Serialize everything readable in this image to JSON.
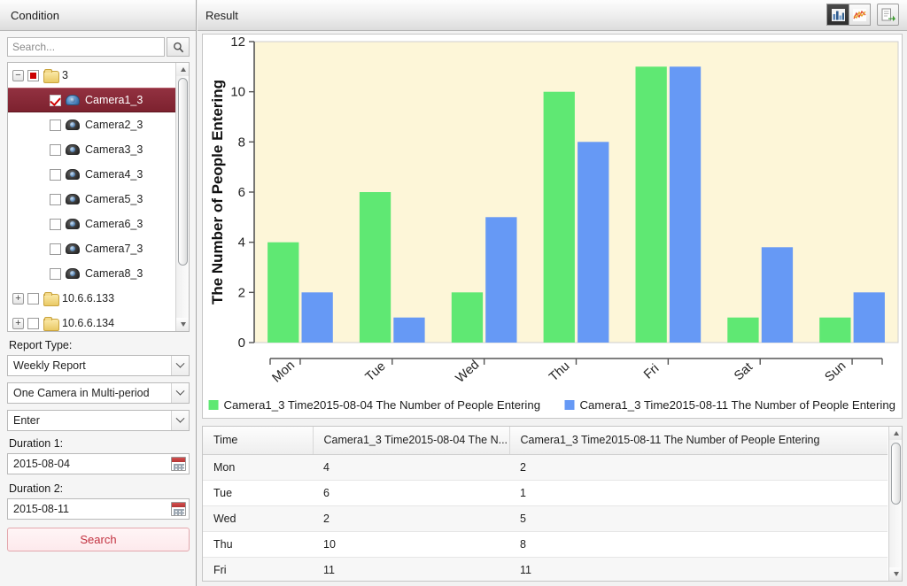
{
  "left": {
    "header": "Condition",
    "search": {
      "placeholder": "Search...",
      "value": "",
      "icon": "search-icon"
    },
    "tree": [
      {
        "label": "3",
        "type": "folder",
        "expander": "−",
        "check": "partial",
        "indent": 0,
        "selected": false
      },
      {
        "label": "Camera1_3",
        "type": "camera",
        "check": "checked",
        "indent": 2,
        "selected": true
      },
      {
        "label": "Camera2_3",
        "type": "camera",
        "check": "unchecked",
        "indent": 2,
        "selected": false
      },
      {
        "label": "Camera3_3",
        "type": "camera",
        "check": "unchecked",
        "indent": 2,
        "selected": false
      },
      {
        "label": "Camera4_3",
        "type": "camera",
        "check": "unchecked",
        "indent": 2,
        "selected": false
      },
      {
        "label": "Camera5_3",
        "type": "camera",
        "check": "unchecked",
        "indent": 2,
        "selected": false
      },
      {
        "label": "Camera6_3",
        "type": "camera",
        "check": "unchecked",
        "indent": 2,
        "selected": false
      },
      {
        "label": "Camera7_3",
        "type": "camera",
        "check": "unchecked",
        "indent": 2,
        "selected": false
      },
      {
        "label": "Camera8_3",
        "type": "camera",
        "check": "unchecked",
        "indent": 2,
        "selected": false
      },
      {
        "label": "10.6.6.133",
        "type": "folder",
        "expander": "+",
        "check": "unchecked",
        "indent": 0,
        "selected": false
      },
      {
        "label": "10.6.6.134",
        "type": "folder",
        "expander": "+",
        "check": "unchecked",
        "indent": 0,
        "selected": false
      }
    ],
    "report_type_label": "Report Type:",
    "report_type_value": "Weekly Report",
    "mode_value": "One Camera in Multi-period",
    "flow_value": "Enter",
    "duration1_label": "Duration 1:",
    "duration1_value": "2015-08-04",
    "duration2_label": "Duration 2:",
    "duration2_value": "2015-08-11",
    "search_button": "Search",
    "calendar_icon": "calendar-icon"
  },
  "right": {
    "header": "Result",
    "toolbar": {
      "bar_chart_icon": "bar-chart-icon",
      "line_chart_icon": "line-chart-icon",
      "export_icon": "export-icon"
    }
  },
  "chart_data": {
    "type": "bar",
    "title": "",
    "xlabel": "",
    "ylabel": "The Number of People Entering",
    "ylim": [
      0,
      12
    ],
    "yticks": [
      0,
      2,
      4,
      6,
      8,
      10,
      12
    ],
    "grid": false,
    "legend_position": "bottom",
    "plot_background": "#FDF6D8",
    "categories": [
      "Mon",
      "Tue",
      "Wed",
      "Thu",
      "Fri",
      "Sat",
      "Sun"
    ],
    "series": [
      {
        "name": "Camera1_3 Time2015-08-04 The Number of People Entering",
        "color": "#5FE873",
        "values": [
          4,
          6,
          2,
          10,
          11,
          1,
          1
        ]
      },
      {
        "name": "Camera1_3 Time2015-08-11 The Number of People Entering",
        "color": "#6699F5",
        "values": [
          2,
          1,
          5,
          8,
          11,
          3.8,
          2
        ]
      }
    ]
  },
  "table": {
    "columns": [
      "Time",
      "Camera1_3 Time2015-08-04 The N...",
      "Camera1_3 Time2015-08-11 The Number of People Entering"
    ],
    "rows": [
      [
        "Mon",
        "4",
        "2"
      ],
      [
        "Tue",
        "6",
        "1"
      ],
      [
        "Wed",
        "2",
        "5"
      ],
      [
        "Thu",
        "10",
        "8"
      ],
      [
        "Fri",
        "11",
        "11"
      ]
    ]
  }
}
